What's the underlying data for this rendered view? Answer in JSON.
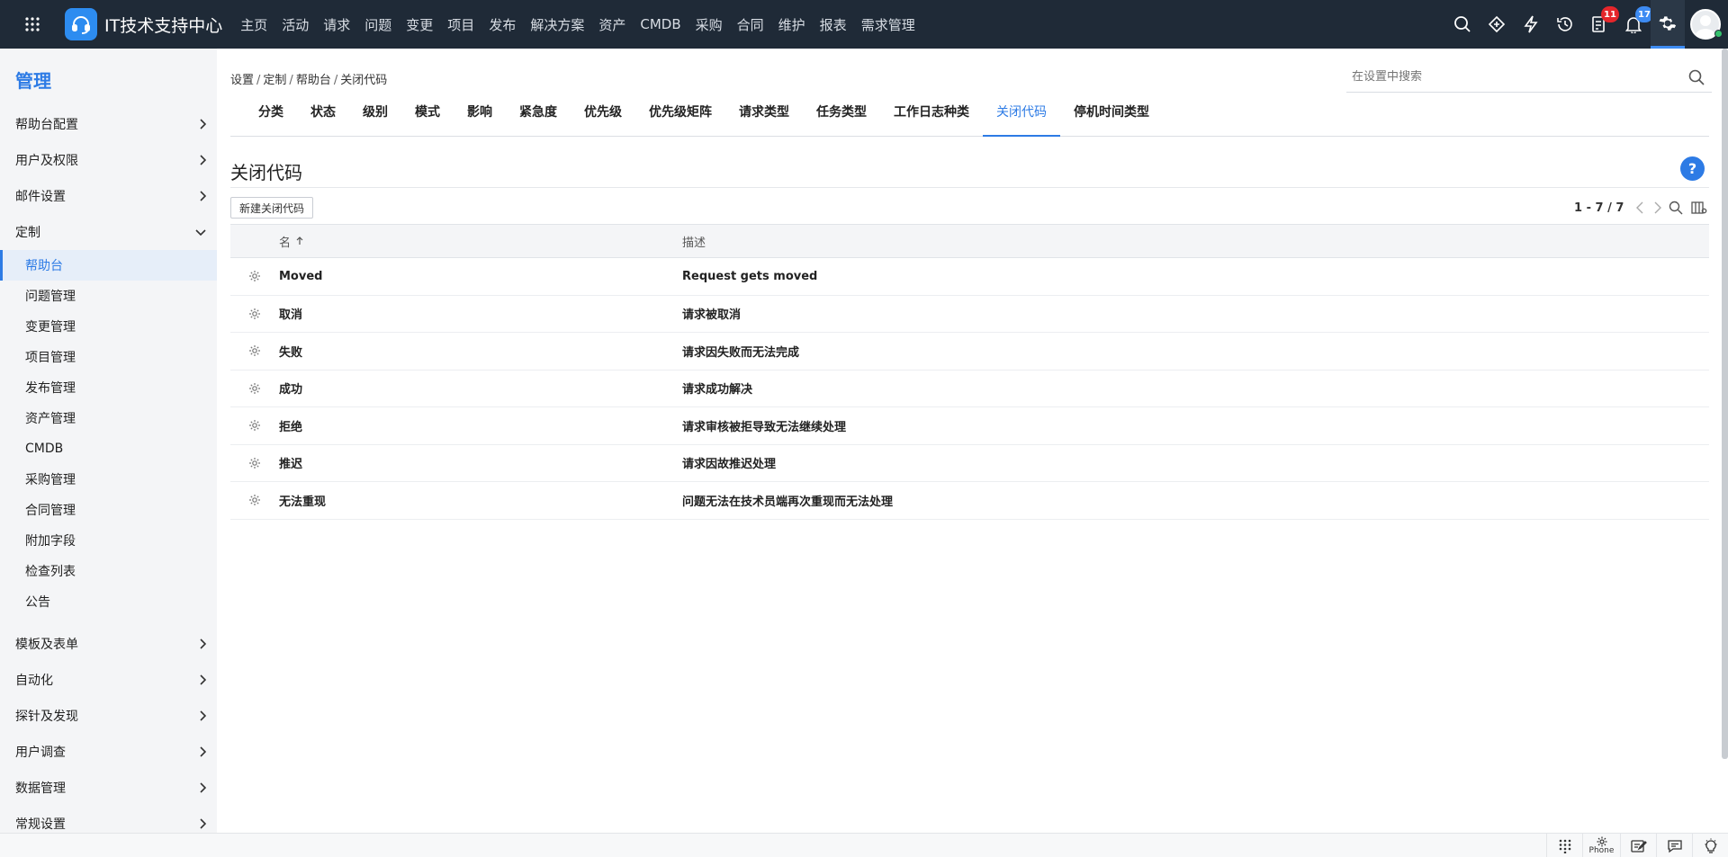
{
  "header": {
    "app_title": "IT技术支持中心",
    "nav": [
      "主页",
      "活动",
      "请求",
      "问题",
      "变更",
      "项目",
      "发布",
      "解决方案",
      "资产",
      "CMDB",
      "采购",
      "合同",
      "维护",
      "报表",
      "需求管理"
    ],
    "badges": {
      "tasks": "11",
      "notifications": "17"
    },
    "icons": [
      "search-icon",
      "diamond-icon",
      "lightning-icon",
      "history-icon",
      "tasks-icon",
      "bell-icon",
      "gear-icon",
      "avatar"
    ]
  },
  "sidebar": {
    "title": "管理",
    "sections_top": [
      {
        "label": "帮助台配置"
      },
      {
        "label": "用户及权限"
      },
      {
        "label": "邮件设置"
      },
      {
        "label": "定制"
      }
    ],
    "customize_items": [
      "帮助台",
      "问题管理",
      "变更管理",
      "项目管理",
      "发布管理",
      "资产管理",
      "CMDB",
      "采购管理",
      "合同管理",
      "附加字段",
      "检查列表",
      "公告"
    ],
    "sections_bottom": [
      {
        "label": "模板及表单"
      },
      {
        "label": "自动化"
      },
      {
        "label": "探针及发现"
      },
      {
        "label": "用户调查"
      },
      {
        "label": "数据管理"
      },
      {
        "label": "常规设置"
      }
    ]
  },
  "main": {
    "breadcrumb": [
      "设置",
      "定制",
      "帮助台",
      "关闭代码"
    ],
    "search_placeholder": "在设置中搜索",
    "tabs": [
      "分类",
      "状态",
      "级别",
      "模式",
      "影响",
      "紧急度",
      "优先级",
      "优先级矩阵",
      "请求类型",
      "任务类型",
      "工作日志种类",
      "关闭代码",
      "停机时间类型"
    ],
    "active_tab": "关闭代码",
    "page_title": "关闭代码",
    "new_button": "新建关闭代码",
    "pager": "1 - 7 / 7",
    "help": "?",
    "table": {
      "headers": [
        "名",
        "描述"
      ],
      "rows": [
        {
          "name": "Moved",
          "desc": "Request gets moved"
        },
        {
          "name": "取消",
          "desc": "请求被取消"
        },
        {
          "name": "失败",
          "desc": "请求因失败而无法完成"
        },
        {
          "name": "成功",
          "desc": "请求成功解决"
        },
        {
          "name": "拒绝",
          "desc": "请求审核被拒导致无法继续处理"
        },
        {
          "name": "推迟",
          "desc": "请求因故推迟处理"
        },
        {
          "name": "无法重现",
          "desc": "问题无法在技术员端再次重现而无法处理"
        }
      ]
    }
  },
  "footer": {
    "phone_label": "Phone"
  },
  "colors": {
    "topbar": "#1f2a37",
    "accent": "#2d7be5",
    "badge_red": "#e5262b",
    "badge_blue": "#3d8bf2"
  }
}
